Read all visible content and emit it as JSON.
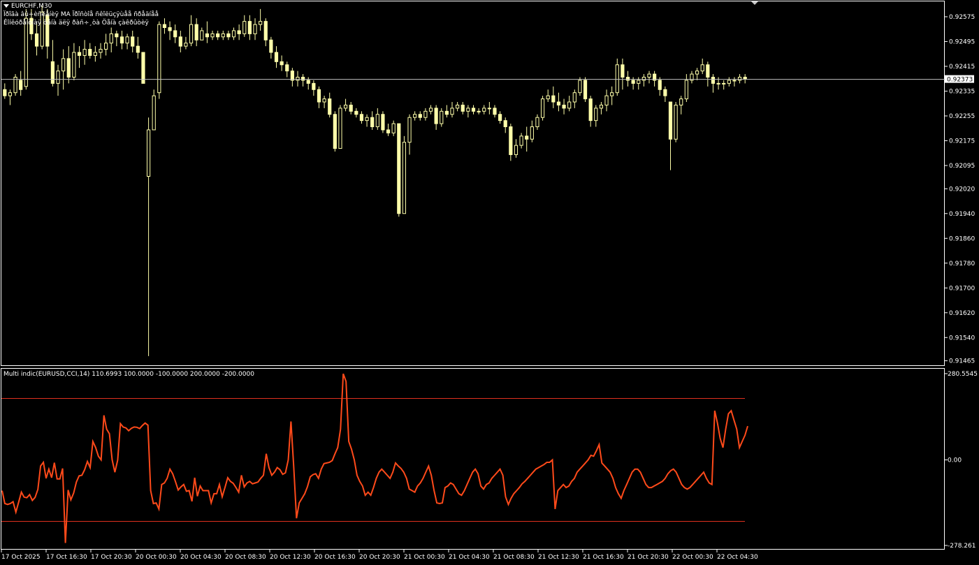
{
  "header": {
    "symbol_timeframe": "EURCHF,M30",
    "line1": "Ïðîãà âû÷èñëåíèÿ MA Ïðîñòîå ñêîëüçÿùåå ñðåäíåå",
    "line2": "Êîíêóðåíòíàÿ öåíà äëÿ ðàñ÷¸òà Öåíà çàêðûòèÿ"
  },
  "indicator": {
    "label": "Multi indic(EURUSD,CCI,14) 110.6993 100.0000 -100.0000 200.0000 -200.0000"
  },
  "colors": {
    "background": "#000000",
    "grid": "#ffffff",
    "bull_candle": "#000000",
    "candle_outline": "#ffffaa",
    "price_line": "#c0c0c0",
    "cci_line": "#ff4a1a",
    "level_line": "#e0301e"
  },
  "price_axis": {
    "ticks": [
      "0.92575",
      "0.92495",
      "0.92415",
      "0.92335",
      "0.92255",
      "0.92175",
      "0.92095",
      "0.92020",
      "0.91940",
      "0.91860",
      "0.91780",
      "0.91700",
      "0.91620",
      "0.91540",
      "0.91465"
    ],
    "current_price": "0.92373"
  },
  "cci_axis": {
    "ticks": [
      "280.5545",
      "0.00",
      "-278.261"
    ]
  },
  "time_axis": {
    "ticks": [
      "17 Oct 2025",
      "17 Oct 16:30",
      "17 Oct 20:30",
      "20 Oct 00:30",
      "20 Oct 04:30",
      "20 Oct 08:30",
      "20 Oct 12:30",
      "20 Oct 16:30",
      "20 Oct 20:30",
      "21 Oct 00:30",
      "21 Oct 04:30",
      "21 Oct 08:30",
      "21 Oct 12:30",
      "21 Oct 16:30",
      "21 Oct 20:30",
      "22 Oct 00:30",
      "22 Oct 04:30"
    ]
  },
  "chart_data": [
    {
      "type": "candlestick",
      "title": "EURCHF,M30",
      "ylim": [
        0.91455,
        0.9262
      ],
      "candles": [
        [
          0.9234,
          0.9236,
          0.9231,
          0.9232
        ],
        [
          0.9232,
          0.9234,
          0.9229,
          0.9233
        ],
        [
          0.9233,
          0.9239,
          0.9232,
          0.9238
        ],
        [
          0.9237,
          0.924,
          0.9232,
          0.9234
        ],
        [
          0.9235,
          0.926,
          0.9234,
          0.9257
        ],
        [
          0.9257,
          0.926,
          0.925,
          0.9252
        ],
        [
          0.9252,
          0.9256,
          0.9245,
          0.9248
        ],
        [
          0.9248,
          0.9261,
          0.9247,
          0.9259
        ],
        [
          0.9258,
          0.926,
          0.9244,
          0.9248
        ],
        [
          0.9243,
          0.925,
          0.9235,
          0.9236
        ],
        [
          0.9236,
          0.9242,
          0.9232,
          0.924
        ],
        [
          0.924,
          0.9247,
          0.9234,
          0.9244
        ],
        [
          0.9244,
          0.9248,
          0.9236,
          0.9238
        ],
        [
          0.9238,
          0.9249,
          0.9237,
          0.9246
        ],
        [
          0.9246,
          0.9248,
          0.9241,
          0.9245
        ],
        [
          0.9245,
          0.925,
          0.9242,
          0.9247
        ],
        [
          0.9247,
          0.9249,
          0.9244,
          0.9245
        ],
        [
          0.9245,
          0.9248,
          0.9243,
          0.9246
        ],
        [
          0.9246,
          0.9249,
          0.9244,
          0.9247
        ],
        [
          0.9247,
          0.9252,
          0.9245,
          0.9249
        ],
        [
          0.9249,
          0.9254,
          0.9246,
          0.9252
        ],
        [
          0.9252,
          0.9253,
          0.9248,
          0.9251
        ],
        [
          0.9251,
          0.9253,
          0.9247,
          0.9249
        ],
        [
          0.9249,
          0.9252,
          0.9247,
          0.9251
        ],
        [
          0.9251,
          0.9253,
          0.9246,
          0.9248
        ],
        [
          0.9248,
          0.9251,
          0.9244,
          0.9246
        ],
        [
          0.9246,
          0.9236,
          0.9238,
          0.9236
        ],
        [
          0.9206,
          0.9225,
          0.9148,
          0.9221
        ],
        [
          0.9221,
          0.9234,
          0.9221,
          0.9232
        ],
        [
          0.9233,
          0.9256,
          0.9231,
          0.9255
        ],
        [
          0.9255,
          0.9257,
          0.9252,
          0.9254
        ],
        [
          0.9254,
          0.9256,
          0.925,
          0.9253
        ],
        [
          0.9253,
          0.9255,
          0.9249,
          0.9251
        ],
        [
          0.9251,
          0.9253,
          0.9246,
          0.9248
        ],
        [
          0.9248,
          0.9251,
          0.9247,
          0.9249
        ],
        [
          0.9249,
          0.9258,
          0.9248,
          0.9255
        ],
        [
          0.9255,
          0.9257,
          0.9248,
          0.925
        ],
        [
          0.925,
          0.9254,
          0.925,
          0.9253
        ],
        [
          0.9252,
          0.9256,
          0.9249,
          0.9251
        ],
        [
          0.9251,
          0.9253,
          0.925,
          0.9252
        ],
        [
          0.9252,
          0.9253,
          0.925,
          0.9251
        ],
        [
          0.9251,
          0.9253,
          0.925,
          0.9252
        ],
        [
          0.9252,
          0.9253,
          0.925,
          0.9251
        ],
        [
          0.9251,
          0.9254,
          0.925,
          0.9253
        ],
        [
          0.9253,
          0.9255,
          0.925,
          0.9252
        ],
        [
          0.9252,
          0.9258,
          0.9251,
          0.9256
        ],
        [
          0.9256,
          0.9258,
          0.925,
          0.9252
        ],
        [
          0.9252,
          0.9257,
          0.925,
          0.9255
        ],
        [
          0.9255,
          0.926,
          0.9253,
          0.9256
        ],
        [
          0.9256,
          0.9257,
          0.9248,
          0.925
        ],
        [
          0.925,
          0.9251,
          0.9244,
          0.9246
        ],
        [
          0.9246,
          0.9248,
          0.9241,
          0.9243
        ],
        [
          0.9243,
          0.9245,
          0.924,
          0.9242
        ],
        [
          0.9242,
          0.9243,
          0.9238,
          0.924
        ],
        [
          0.924,
          0.9241,
          0.9235,
          0.9237
        ],
        [
          0.9237,
          0.924,
          0.9235,
          0.9238
        ],
        [
          0.9238,
          0.9239,
          0.9235,
          0.9237
        ],
        [
          0.9237,
          0.9238,
          0.9234,
          0.9236
        ],
        [
          0.9236,
          0.9237,
          0.9232,
          0.9234
        ],
        [
          0.9234,
          0.9235,
          0.9228,
          0.923
        ],
        [
          0.923,
          0.9232,
          0.9228,
          0.9231
        ],
        [
          0.9231,
          0.9233,
          0.9225,
          0.9226
        ],
        [
          0.9226,
          0.9227,
          0.9214,
          0.9215
        ],
        [
          0.9215,
          0.9229,
          0.9215,
          0.9228
        ],
        [
          0.9228,
          0.9231,
          0.9227,
          0.9229
        ],
        [
          0.9229,
          0.923,
          0.9226,
          0.9227
        ],
        [
          0.9227,
          0.9228,
          0.9225,
          0.9226
        ],
        [
          0.9226,
          0.9227,
          0.9223,
          0.9224
        ],
        [
          0.9224,
          0.9226,
          0.9222,
          0.9225
        ],
        [
          0.9225,
          0.9227,
          0.9221,
          0.9222
        ],
        [
          0.9222,
          0.9228,
          0.9221,
          0.9226
        ],
        [
          0.9226,
          0.9227,
          0.922,
          0.9221
        ],
        [
          0.9221,
          0.9223,
          0.9219,
          0.922
        ],
        [
          0.922,
          0.9224,
          0.9219,
          0.9223
        ],
        [
          0.9223,
          0.9223,
          0.9193,
          0.9194
        ],
        [
          0.9194,
          0.9219,
          0.9194,
          0.9217
        ],
        [
          0.9217,
          0.9226,
          0.9213,
          0.9225
        ],
        [
          0.9225,
          0.9227,
          0.9224,
          0.9226
        ],
        [
          0.9226,
          0.9227,
          0.9224,
          0.9225
        ],
        [
          0.9225,
          0.9228,
          0.9224,
          0.9227
        ],
        [
          0.9227,
          0.9229,
          0.9226,
          0.9228
        ],
        [
          0.9228,
          0.9229,
          0.9221,
          0.9223
        ],
        [
          0.9223,
          0.9228,
          0.9222,
          0.9227
        ],
        [
          0.9227,
          0.9229,
          0.9225,
          0.9226
        ],
        [
          0.9226,
          0.923,
          0.9225,
          0.9228
        ],
        [
          0.9228,
          0.923,
          0.9227,
          0.9229
        ],
        [
          0.9229,
          0.923,
          0.9226,
          0.9227
        ],
        [
          0.9227,
          0.9229,
          0.9225,
          0.9228
        ],
        [
          0.9228,
          0.9229,
          0.9226,
          0.9227
        ],
        [
          0.9227,
          0.9228,
          0.9226,
          0.9227
        ],
        [
          0.9227,
          0.9229,
          0.9226,
          0.9228
        ],
        [
          0.9228,
          0.923,
          0.9226,
          0.9228
        ],
        [
          0.9228,
          0.9229,
          0.9225,
          0.9226
        ],
        [
          0.9226,
          0.9227,
          0.9223,
          0.9224
        ],
        [
          0.9224,
          0.9225,
          0.922,
          0.9222
        ],
        [
          0.9222,
          0.9223,
          0.9211,
          0.9213
        ],
        [
          0.9213,
          0.9218,
          0.9212,
          0.9216
        ],
        [
          0.9216,
          0.922,
          0.9215,
          0.9219
        ],
        [
          0.9219,
          0.9222,
          0.9214,
          0.9218
        ],
        [
          0.9218,
          0.9224,
          0.9217,
          0.9222
        ],
        [
          0.9222,
          0.9226,
          0.9221,
          0.9225
        ],
        [
          0.9225,
          0.9232,
          0.9224,
          0.9231
        ],
        [
          0.9231,
          0.9234,
          0.923,
          0.9232
        ],
        [
          0.9232,
          0.9235,
          0.9228,
          0.923
        ],
        [
          0.923,
          0.9233,
          0.9227,
          0.9229
        ],
        [
          0.9229,
          0.9231,
          0.9226,
          0.9228
        ],
        [
          0.9228,
          0.9232,
          0.9227,
          0.923
        ],
        [
          0.923,
          0.9234,
          0.9228,
          0.9233
        ],
        [
          0.9233,
          0.9238,
          0.9232,
          0.9237
        ],
        [
          0.9237,
          0.9238,
          0.923,
          0.9231
        ],
        [
          0.9231,
          0.9232,
          0.9222,
          0.9224
        ],
        [
          0.9224,
          0.9229,
          0.9222,
          0.9228
        ],
        [
          0.9228,
          0.923,
          0.9226,
          0.9229
        ],
        [
          0.9229,
          0.9234,
          0.9227,
          0.9232
        ],
        [
          0.9232,
          0.9235,
          0.9229,
          0.9233
        ],
        [
          0.9233,
          0.9244,
          0.9232,
          0.9242
        ],
        [
          0.9242,
          0.9244,
          0.9234,
          0.9238
        ],
        [
          0.9238,
          0.924,
          0.9235,
          0.9237
        ],
        [
          0.9237,
          0.9238,
          0.9234,
          0.9236
        ],
        [
          0.9236,
          0.9238,
          0.9234,
          0.9237
        ],
        [
          0.9237,
          0.9239,
          0.9235,
          0.9238
        ],
        [
          0.9238,
          0.924,
          0.9236,
          0.9239
        ],
        [
          0.9239,
          0.924,
          0.9235,
          0.9237
        ],
        [
          0.9237,
          0.9238,
          0.9232,
          0.9234
        ],
        [
          0.9234,
          0.9235,
          0.923,
          0.9232
        ],
        [
          0.923,
          0.923,
          0.9208,
          0.9218
        ],
        [
          0.9218,
          0.923,
          0.9217,
          0.9229
        ],
        [
          0.9229,
          0.9232,
          0.9226,
          0.9231
        ],
        [
          0.9231,
          0.9239,
          0.923,
          0.9237
        ],
        [
          0.9237,
          0.924,
          0.9236,
          0.9239
        ],
        [
          0.9239,
          0.9241,
          0.9237,
          0.924
        ],
        [
          0.924,
          0.9244,
          0.9239,
          0.9242
        ],
        [
          0.9242,
          0.9243,
          0.9235,
          0.9238
        ],
        [
          0.9238,
          0.9239,
          0.9233,
          0.9236
        ],
        [
          0.9236,
          0.9238,
          0.9234,
          0.9236
        ],
        [
          0.9236,
          0.9237,
          0.9234,
          0.9236
        ],
        [
          0.9236,
          0.9238,
          0.9235,
          0.9237
        ],
        [
          0.9237,
          0.9238,
          0.9235,
          0.9237
        ],
        [
          0.9237,
          0.9239,
          0.9236,
          0.9238
        ],
        [
          0.9238,
          0.9239,
          0.9236,
          0.92375
        ]
      ]
    },
    {
      "type": "line",
      "title": "Multi indic(EURUSD,CCI,14)",
      "ylim": [
        -278.261,
        280.5545
      ],
      "levels": [
        200,
        -200
      ],
      "values": [
        -100,
        -142,
        -145,
        -142,
        -136,
        -170,
        -138,
        -105,
        -121,
        -123,
        -113,
        -132,
        -122,
        -96,
        -20,
        -8,
        -60,
        -30,
        -58,
        -9,
        -62,
        -62,
        -28,
        -270,
        -98,
        -130,
        -108,
        -72,
        -52,
        -50,
        -32,
        -5,
        -25,
        60,
        40,
        12,
        0,
        145,
        100,
        85,
        0,
        -40,
        -1,
        118,
        107,
        104,
        95,
        103,
        107,
        106,
        102,
        112,
        120,
        113,
        -100,
        -142,
        -140,
        -160,
        -80,
        -75,
        -60,
        -30,
        -45,
        -70,
        -98,
        -88,
        -80,
        -102,
        -100,
        -135,
        -58,
        -118,
        -85,
        -100,
        -100,
        -100,
        -140,
        -110,
        -110,
        -80,
        -120,
        -90,
        -58,
        -70,
        -76,
        -90,
        -105,
        -50,
        -88,
        -75,
        -70,
        -78,
        -75,
        -72,
        -60,
        -50,
        20,
        -25,
        -50,
        -40,
        -25,
        -32,
        -47,
        -42,
        0,
        125,
        -25,
        -190,
        -140,
        -125,
        -110,
        -87,
        -55,
        -48,
        -45,
        -60,
        -30,
        -12,
        -10,
        -8,
        -2,
        20,
        40,
        100,
        280,
        255,
        60,
        35,
        0,
        -50,
        -70,
        -85,
        -115,
        -105,
        -115,
        -90,
        -60,
        -40,
        -30,
        -40,
        -50,
        -60,
        -40,
        -10,
        -20,
        -28,
        -40,
        -60,
        -95,
        -100,
        -105,
        -85,
        -75,
        -60,
        -40,
        -20,
        -50,
        -100,
        -140,
        -142,
        -140,
        -90,
        -85,
        -75,
        -80,
        -95,
        -110,
        -115,
        -100,
        -80,
        -60,
        -40,
        -30,
        -45,
        -85,
        -95,
        -80,
        -75,
        -60,
        -50,
        -40,
        -30,
        -50,
        -120,
        -145,
        -125,
        -110,
        -100,
        -90,
        -78,
        -70,
        -60,
        -50,
        -40,
        -30,
        -25,
        -20,
        -15,
        -8,
        -8,
        0,
        -160,
        -100,
        -90,
        -80,
        -90,
        -85,
        -70,
        -60,
        -40,
        -30,
        -20,
        -10,
        0,
        15,
        12,
        30,
        50,
        -10,
        -20,
        -30,
        -40,
        -60,
        -90,
        -110,
        -125,
        -100,
        -80,
        -60,
        -40,
        -30,
        -30,
        -40,
        -60,
        -80,
        -90,
        -90,
        -85,
        -80,
        -75,
        -70,
        -60,
        -45,
        -35,
        -30,
        -40,
        -60,
        -80,
        -90,
        -95,
        -90,
        -80,
        -70,
        -60,
        -50,
        -40,
        -60,
        -75,
        -80,
        160,
        120,
        70,
        40,
        100,
        150,
        160,
        130,
        100,
        40,
        60,
        80,
        110
      ]
    }
  ]
}
